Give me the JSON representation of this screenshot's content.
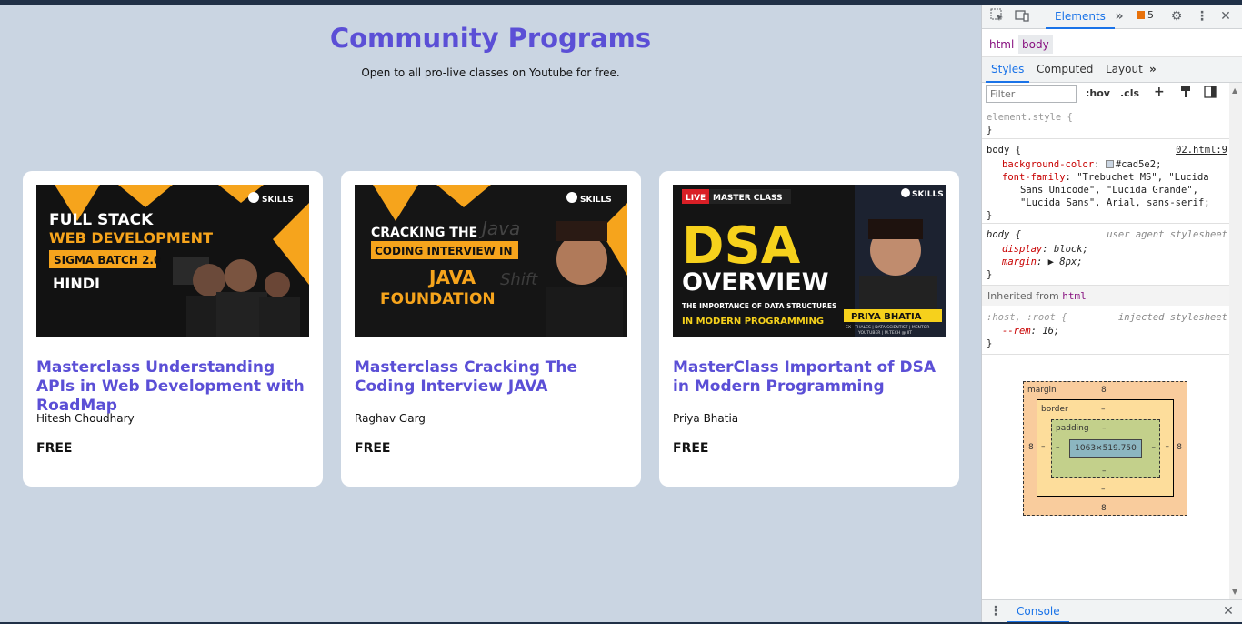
{
  "page": {
    "title": "Community Programs",
    "subtitle": "Open to all pro-live classes on Youtube for free.",
    "background": "#cad5e2",
    "accent": "#5b4fd6"
  },
  "cards": [
    {
      "title": "Masterclass Understanding APIs in Web Development with RoadMap",
      "author": "Hitesh Choudhary",
      "price": "FREE",
      "thumb": {
        "brand": "SKILLS",
        "line1": "FULL STACK",
        "line2": "WEB DEVELOPMENT",
        "line3": "SIGMA BATCH 2.0",
        "line4": "HINDI"
      }
    },
    {
      "title": "Masterclass Cracking The Coding Interview JAVA",
      "author": "Raghav Garg",
      "price": "FREE",
      "thumb": {
        "brand": "SKILLS",
        "line1": "CRACKING THE",
        "line2": "CODING INTERVIEW IN",
        "line3": "JAVA",
        "line4": "FOUNDATION"
      }
    },
    {
      "title": "MasterClass Important of DSA in Modern Programming",
      "author": "Priya Bhatia",
      "price": "FREE",
      "thumb": {
        "brand": "SKILLS",
        "badge_live": "LIVE",
        "badge_text": "MASTER CLASS",
        "line1": "DSA",
        "line2": "OVERVIEW",
        "line3": "THE IMPORTANCE OF DATA STRUCTURES",
        "line4": "IN MODERN PROGRAMMING",
        "name": "PRIYA BHATIA",
        "role": "EX - THALES | DATA SCIENTIST | MENTOR",
        "role2": "YOUTUBER | M.TECH @ IIT"
      }
    }
  ],
  "devtools": {
    "tab_elements": "Elements",
    "issues_count": "5",
    "breadcrumbs": [
      "html",
      "body"
    ],
    "subtabs": [
      "Styles",
      "Computed",
      "Layout"
    ],
    "filter_placeholder": "Filter",
    "hov": ":hov",
    "cls": ".cls",
    "element_style": "element.style {",
    "close_brace": "}",
    "body_rule": {
      "selector": "body {",
      "source": "02.html:9",
      "bg_prop": "background-color",
      "bg_value": "#cad5e2;",
      "ff_prop": "font-family",
      "ff_value_1": "\"Trebuchet MS\", \"Lucida",
      "ff_value_2": "Sans Unicode\", \"Lucida Grande\",",
      "ff_value_3": "\"Lucida Sans\", Arial, sans-serif;"
    },
    "ua_rule": {
      "selector": "body {",
      "source": "user agent stylesheet",
      "display_prop": "display",
      "display_value": "block;",
      "margin_prop": "margin",
      "margin_value": "8px;"
    },
    "inherited_label": "Inherited from",
    "inherited_tag": "html",
    "host_rule": {
      "selector": ":host, :root {",
      "source": "injected stylesheet",
      "prop": "--rem",
      "value": "16;"
    },
    "box_model": {
      "margin_label": "margin",
      "border_label": "border",
      "padding_label": "padding",
      "margin_value": "8",
      "border_value": "–",
      "padding_value": "–",
      "content_size": "1063×519.750"
    },
    "console_tab": "Console"
  }
}
